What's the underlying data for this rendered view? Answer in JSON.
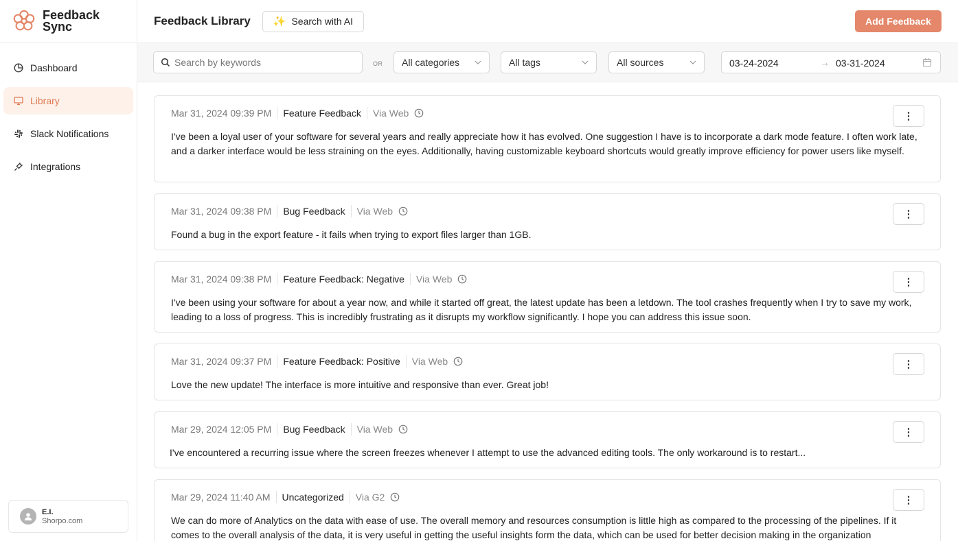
{
  "brand": {
    "name": "Feedback Sync"
  },
  "sidebar": {
    "items": [
      {
        "label": "Dashboard",
        "icon": "pie-chart-icon"
      },
      {
        "label": "Library",
        "icon": "monitor-icon",
        "active": true
      },
      {
        "label": "Slack Notifications",
        "icon": "slack-icon"
      },
      {
        "label": "Integrations",
        "icon": "plug-icon"
      }
    ],
    "user": {
      "name": "E.I.",
      "org": "Shorpo.com"
    }
  },
  "header": {
    "title": "Feedback Library",
    "ai_button": "Search with AI",
    "add_button": "Add Feedback"
  },
  "filters": {
    "search_placeholder": "Search by keywords",
    "or_label": "OR",
    "categories": "All categories",
    "tags": "All tags",
    "sources": "All sources",
    "date_from": "03-24-2024",
    "date_to": "03-31-2024"
  },
  "feedback": [
    {
      "date": "Mar 31, 2024 09:39 PM",
      "category": "Feature Feedback",
      "source": "Via Web",
      "text": "I've been a loyal user of your software for several years and really appreciate how it has evolved. One suggestion I have is to incorporate a dark mode feature. I often work late, and a darker interface would be less straining on the eyes. Additionally, having customizable keyboard shortcuts would greatly improve efficiency for power users like myself."
    },
    {
      "date": "Mar 31, 2024 09:38 PM",
      "category": "Bug Feedback",
      "source": "Via Web",
      "text": "Found a bug in the export feature - it fails when trying to export files larger than 1GB."
    },
    {
      "date": "Mar 31, 2024 09:38 PM",
      "category": "Feature Feedback: Negative",
      "source": "Via Web",
      "text": "I've been using your software for about a year now, and while it started off great, the latest update has been a letdown. The tool crashes frequently when I try to save my work, leading to a loss of progress. This is incredibly frustrating as it disrupts my workflow significantly. I hope you can address this issue soon."
    },
    {
      "date": "Mar 31, 2024 09:37 PM",
      "category": "Feature Feedback: Positive",
      "source": "Via Web",
      "text": "Love the new update! The interface is more intuitive and responsive than ever. Great job!"
    },
    {
      "date": "Mar 29, 2024 12:05 PM",
      "category": "Bug Feedback",
      "source": "Via Web",
      "text": "I've encountered a recurring issue where the screen freezes whenever I attempt to use the advanced editing tools. The only workaround is to restart..."
    },
    {
      "date": "Mar 29, 2024 11:40 AM",
      "category": "Uncategorized",
      "source": "Via G2",
      "text": "We can do more of Analytics on the data with ease of use. The overall memory and resources consumption is little high as compared to the processing of the pipelines. If it comes to the overall analysis of the data, it is very useful in getting the useful insights form the data, which can be used for better decision making in the organization"
    }
  ],
  "colors": {
    "accent": "#e4876a",
    "active_bg": "#fdf1ea",
    "active_text": "#e07a53"
  }
}
